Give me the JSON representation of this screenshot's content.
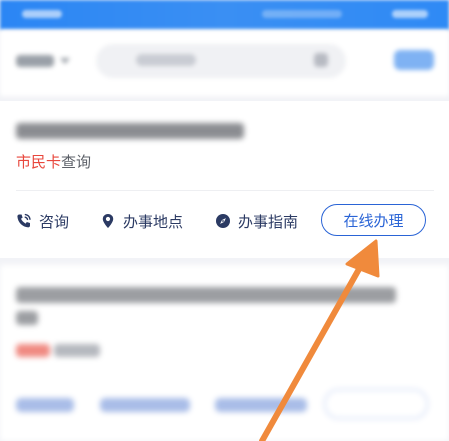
{
  "card": {
    "tag_primary": "市民卡",
    "tag_secondary": "查询",
    "actions": {
      "consult_label": "咨询",
      "location_label": "办事地点",
      "guide_label": "办事指南",
      "online_label": "在线办理"
    }
  },
  "colors": {
    "header_blue": "#2b86f4",
    "tag_red": "#e8473c",
    "action_navy": "#2b3a63",
    "button_blue": "#2a64d6",
    "arrow_orange": "#f08a3c"
  },
  "icons": {
    "consult": "phone-icon",
    "location": "location-pin-icon",
    "guide": "compass-icon",
    "annotation": "arrow-icon"
  }
}
